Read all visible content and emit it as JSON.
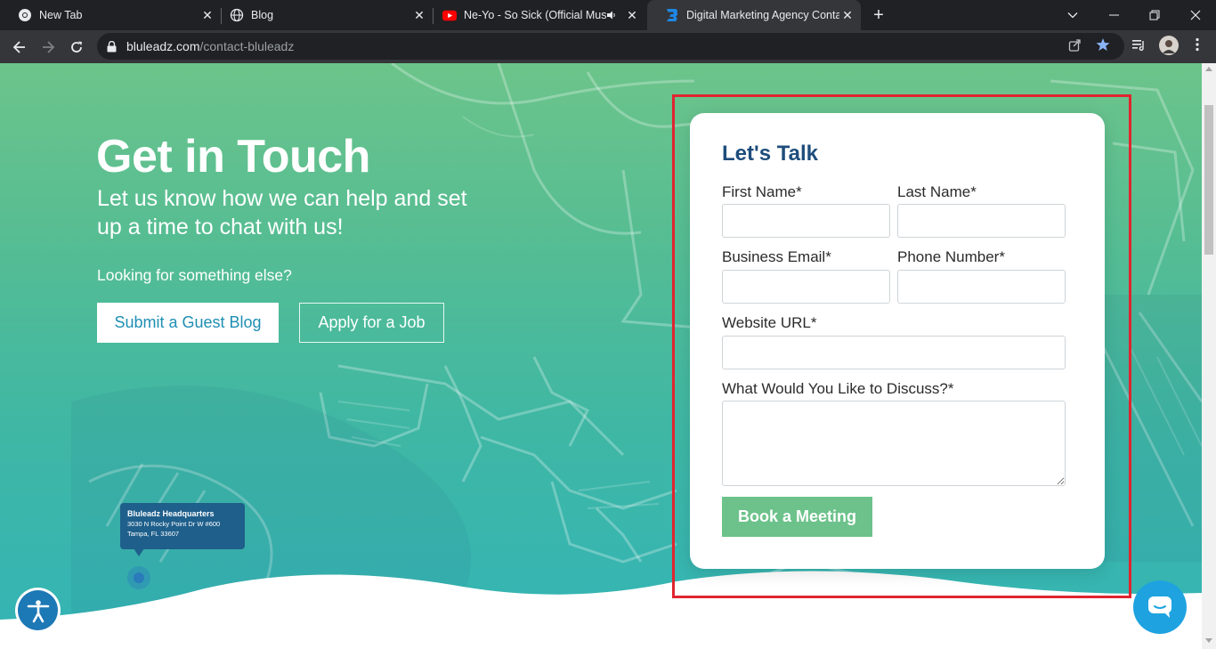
{
  "browser": {
    "tabs": [
      {
        "title": "New Tab",
        "icon": "chrome-icon",
        "active": false
      },
      {
        "title": "Blog",
        "icon": "globe-icon",
        "active": false
      },
      {
        "title": "Ne-Yo - So Sick (Official Mus",
        "icon": "youtube-icon",
        "active": false,
        "audio": true
      },
      {
        "title": "Digital Marketing Agency Contac",
        "icon": "bluleadz-icon",
        "active": true
      }
    ],
    "url_domain": "bluleadz.com",
    "url_path": "/contact-bluleadz"
  },
  "hero": {
    "title": "Get in Touch",
    "subtitle": "Let us know how we can help and set up a time to chat with us!",
    "question": "Looking for something else?",
    "guest_blog_label": "Submit a Guest Blog",
    "job_label": "Apply for a Job"
  },
  "hq": {
    "title": "Bluleadz Headquarters",
    "address_line1": "3030 N Rocky Point Dr W #600",
    "address_line2": "Tampa, FL 33607"
  },
  "form": {
    "heading": "Let's Talk",
    "first_name_label": "First Name*",
    "last_name_label": "Last Name*",
    "email_label": "Business Email*",
    "phone_label": "Phone Number*",
    "website_label": "Website URL*",
    "discuss_label": "What Would You Like to Discuss?*",
    "submit_label": "Book a Meeting",
    "first_name_value": "",
    "last_name_value": "",
    "email_value": "",
    "phone_value": "",
    "website_value": "",
    "discuss_value": ""
  },
  "colors": {
    "brand_dark_blue": "#1e4d7b",
    "brand_green": "#6cc28a",
    "brand_teal": "#33b4b6",
    "link_blue": "#1e8fb4",
    "highlight_red": "#e02530",
    "chat_blue": "#1ea3e0"
  }
}
